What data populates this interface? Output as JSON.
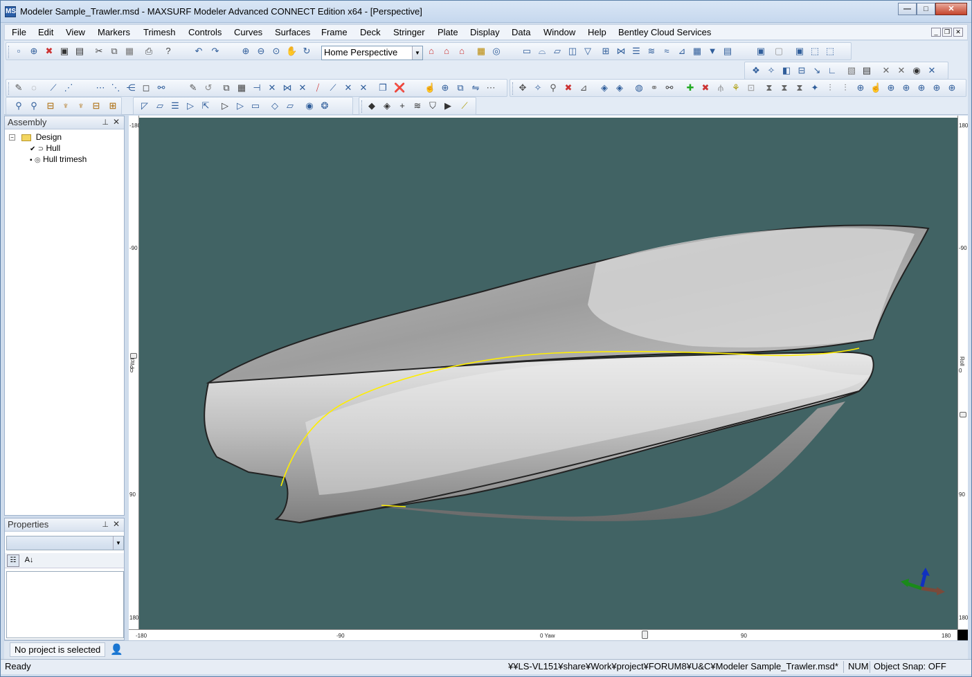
{
  "window": {
    "title": "Modeler Sample_Trawler.msd - MAXSURF Modeler Advanced CONNECT Edition x64 - [Perspective]",
    "app_icon": "MS"
  },
  "window_controls": {
    "minimize": "—",
    "maximize": "□",
    "close": "✕"
  },
  "menu": [
    "File",
    "Edit",
    "View",
    "Markers",
    "Trimesh",
    "Controls",
    "Curves",
    "Surfaces",
    "Frame",
    "Deck",
    "Stringer",
    "Plate",
    "Display",
    "Data",
    "Window",
    "Help",
    "Bentley Cloud Services"
  ],
  "toolbar": {
    "view_select": "Home Perspective"
  },
  "assembly": {
    "title": "Assembly",
    "items": [
      {
        "label": "Design",
        "icon": "folder-icon"
      },
      {
        "label": "Hull",
        "icon": "surface-icon"
      },
      {
        "label": "Hull trimesh",
        "icon": "trimesh-icon"
      }
    ]
  },
  "properties": {
    "title": "Properties",
    "selector_value": ""
  },
  "rulers": {
    "left": [
      "-180",
      "-90",
      "0",
      "90",
      "180"
    ],
    "left_label": "Pitch",
    "right": [
      "180",
      "-90",
      "0",
      "90",
      "180"
    ],
    "right_label": "Roll",
    "bottom": [
      "-180",
      "-90",
      "0 Yaw",
      "90",
      "180"
    ]
  },
  "project_status": {
    "text": "No project is selected"
  },
  "status": {
    "ready": "Ready",
    "path": "¥¥LS-VL151¥share¥Work¥project¥FORUM8¥U&C¥Modeler Sample_Trawler.msd*",
    "num": "NUM",
    "snap": "Object Snap: OFF"
  },
  "colors": {
    "viewport_bg": "#416364",
    "hull_light": "#e6e6e6",
    "hull_dark": "#8a8a8a",
    "waterline": "#ffee00"
  }
}
